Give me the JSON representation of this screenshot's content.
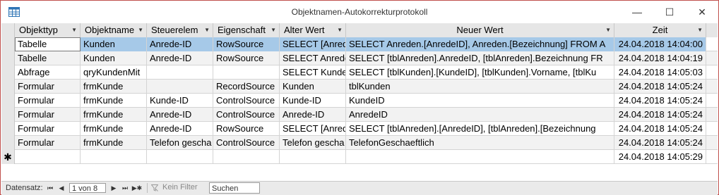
{
  "window": {
    "title": "Objektnamen-Autokorrekturprotokoll",
    "minimize_glyph": "—",
    "maximize_glyph": "☐",
    "close_glyph": "✕"
  },
  "grid": {
    "columns": [
      "Objekttyp",
      "Objektname",
      "Steuerelem",
      "Eigenschaft",
      "Alter Wert",
      "Neuer Wert",
      "Zeit"
    ],
    "rows": [
      [
        "Tabelle",
        "Kunden",
        "Anrede-ID",
        "RowSource",
        "SELECT [Anred",
        "SELECT Anreden.[AnredeID], Anreden.[Bezeichnung] FROM A",
        "24.04.2018 14:04:00"
      ],
      [
        "Tabelle",
        "Kunden",
        "Anrede-ID",
        "RowSource",
        "SELECT Anrede",
        "SELECT [tblAnreden].AnredeID, [tblAnreden].Bezeichnung FR",
        "24.04.2018 14:04:19"
      ],
      [
        "Abfrage",
        "qryKundenMit",
        "",
        "",
        "SELECT Kunder",
        "SELECT [tblKunden].[KundeID], [tblKunden].Vorname, [tblKu",
        "24.04.2018 14:05:03"
      ],
      [
        "Formular",
        "frmKunde",
        "",
        "RecordSource",
        "Kunden",
        "tblKunden",
        "24.04.2018 14:05:24"
      ],
      [
        "Formular",
        "frmKunde",
        "Kunde-ID",
        "ControlSource",
        "Kunde-ID",
        "KundeID",
        "24.04.2018 14:05:24"
      ],
      [
        "Formular",
        "frmKunde",
        "Anrede-ID",
        "ControlSource",
        "Anrede-ID",
        "AnredeID",
        "24.04.2018 14:05:24"
      ],
      [
        "Formular",
        "frmKunde",
        "Anrede-ID",
        "RowSource",
        "SELECT [Anred",
        "SELECT [tblAnreden].[AnredeID], [tblAnreden].[Bezeichnung",
        "24.04.2018 14:05:24"
      ],
      [
        "Formular",
        "frmKunde",
        "Telefon gescha",
        "ControlSource",
        "Telefon gescha",
        "TelefonGeschaeftlich",
        "24.04.2018 14:05:24"
      ]
    ],
    "new_row": {
      "marker": "✱",
      "time": "24.04.2018 14:05:29"
    }
  },
  "statusbar": {
    "label": "Datensatz:",
    "first": "⏮",
    "prev": "◀",
    "record": "1 von 8",
    "next": "▶",
    "last": "⏭",
    "new": "▶✱",
    "filter": "Kein Filter",
    "search": "Suchen"
  },
  "colors": {
    "border": "#c0504d",
    "selection": "#a6c9e8",
    "header": "#e6e6e6"
  }
}
